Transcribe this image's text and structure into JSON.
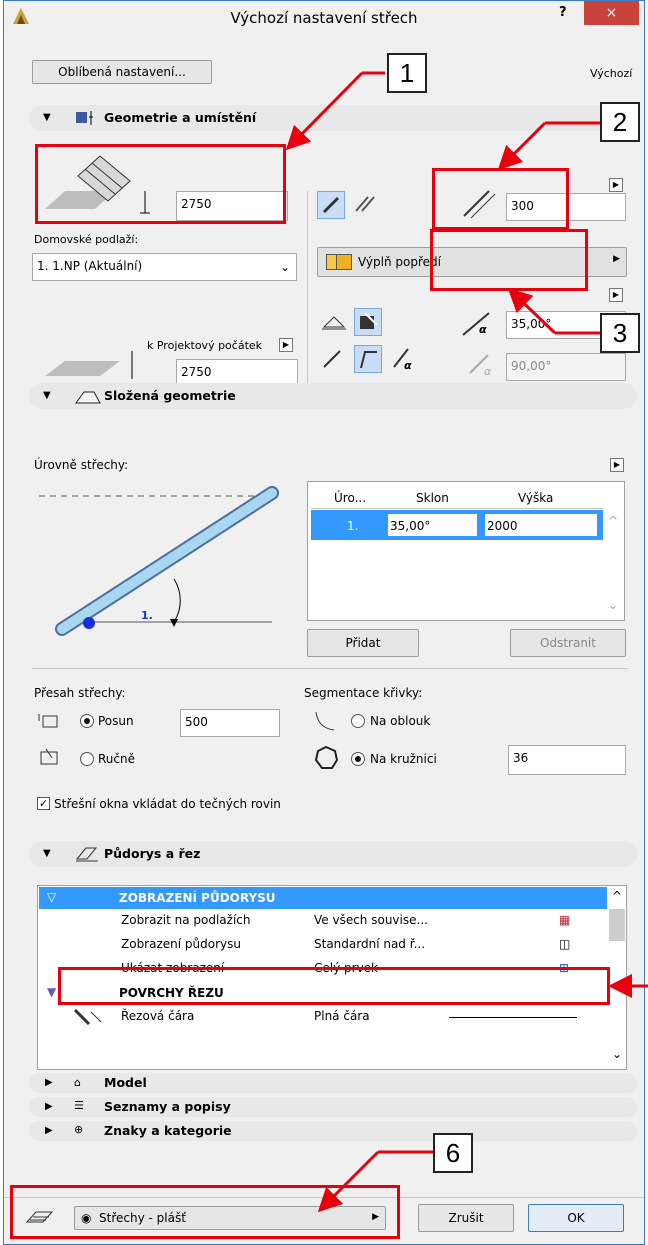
{
  "window": {
    "title": "Výchozí nastavení střech",
    "help": "?",
    "close": "×"
  },
  "top": {
    "favorites": "Oblíbená nastavení...",
    "default": "Výchozí"
  },
  "geometry": {
    "header": "Geometrie a umístění",
    "height_value": "2750",
    "home_story_label": "Domovské podlaží:",
    "home_story_value": "1. 1.NP (Aktuální)",
    "thickness_value": "300",
    "fill_label": "Výplň popředí",
    "angle_value": "35,00°",
    "angle2_value": "90,00°",
    "project_zero_label": "k Projektový počátek",
    "project_zero_value": "2750"
  },
  "complex": {
    "header": "Složená geometrie",
    "levels_label": "Úrovně střechy:",
    "angle_marker": "1.",
    "columns": [
      "Úro...",
      "Sklon",
      "Výška"
    ],
    "rows": [
      {
        "level": "1.",
        "slope": "35,00°",
        "height": "2000"
      }
    ],
    "add_button": "Přidat",
    "remove_button": "Odstranit",
    "overhang_label": "Přesah střechy:",
    "offset_option": "Posun",
    "offset_value": "500",
    "manual_option": "Ručně",
    "segmentation_label": "Segmentace křivky:",
    "arc_option": "Na oblouk",
    "circle_option": "Na kružnici",
    "segments_value": "36",
    "skylights_label": "Střešní okna vkládat do tečných rovin"
  },
  "floorplan": {
    "header": "Půdorys a řez",
    "group1": "ZOBRAZENÍ PŮDORYSU",
    "rows": [
      {
        "name": "Zobrazit na podlažích",
        "value": "Ve všech souvise..."
      },
      {
        "name": "Zobrazení půdorysu",
        "value": "Standardní nad ř..."
      },
      {
        "name": "Ukázat zobrazení",
        "value": "Celý prvek"
      }
    ],
    "group2": "POVRCHY ŘEZU",
    "cut_row": {
      "name": "Řezová čára",
      "value": "Plná čára"
    }
  },
  "collapsed": [
    "Model",
    "Seznamy a popisy",
    "Znaky a kategorie"
  ],
  "bottom": {
    "layer": "Střechy - plášť",
    "cancel": "Zrušit",
    "ok": "OK"
  },
  "callouts": [
    "1",
    "2",
    "3",
    "6"
  ],
  "colors": {
    "annotation": "#e8000d",
    "selection": "#3399ff",
    "close": "#c7433b"
  }
}
